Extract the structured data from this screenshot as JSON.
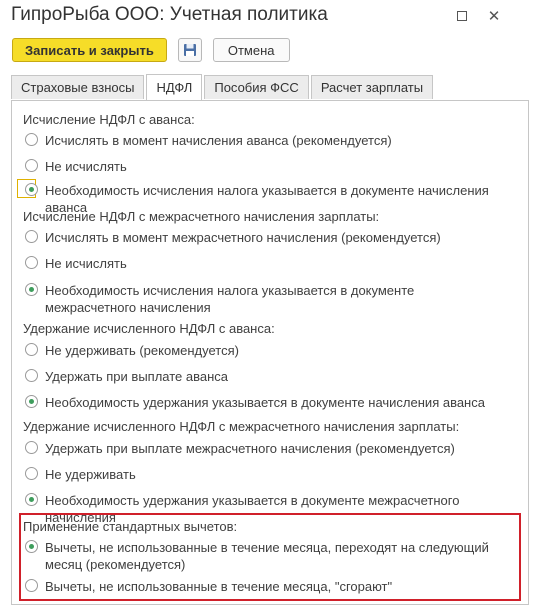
{
  "window": {
    "title": "ГипроРыба ООО: Учетная политика"
  },
  "toolbar": {
    "save_close_label": "Записать и закрыть",
    "cancel_label": "Отмена"
  },
  "tabs": [
    {
      "label": "Страховые взносы"
    },
    {
      "label": "НДФЛ"
    },
    {
      "label": "Пособия ФСС"
    },
    {
      "label": "Расчет зарплаты"
    }
  ],
  "groups": [
    {
      "label": "Исчисление НДФЛ с аванса:",
      "options": [
        {
          "text": "Исчислять в момент начисления аванса (рекомендуется)",
          "checked": false
        },
        {
          "text": "Не исчислять",
          "checked": false
        },
        {
          "text": "Необходимость исчисления налога указывается в документе начисления аванса",
          "checked": true
        }
      ]
    },
    {
      "label": "Исчисление НДФЛ с межрасчетного начисления зарплаты:",
      "options": [
        {
          "text": "Исчислять в момент межрасчетного начисления (рекомендуется)",
          "checked": false
        },
        {
          "text": "Не исчислять",
          "checked": false
        },
        {
          "text": "Необходимость исчисления налога указывается в документе межрасчетного начисления",
          "checked": true
        }
      ]
    },
    {
      "label": "Удержание исчисленного НДФЛ с аванса:",
      "options": [
        {
          "text": "Не удерживать (рекомендуется)",
          "checked": false
        },
        {
          "text": "Удержать при выплате аванса",
          "checked": false
        },
        {
          "text": "Необходимость удержания указывается в документе начисления аванса",
          "checked": true
        }
      ]
    },
    {
      "label": "Удержание исчисленного НДФЛ с межрасчетного начисления зарплаты:",
      "options": [
        {
          "text": "Удержать при выплате межрасчетного начисления (рекомендуется)",
          "checked": false
        },
        {
          "text": "Не удерживать",
          "checked": false
        },
        {
          "text": "Необходимость удержания указывается в документе межрасчетного начисления",
          "checked": true
        }
      ]
    },
    {
      "label": "Применение стандартных вычетов:",
      "options": [
        {
          "text": "Вычеты, не использованные в течение месяца, переходят на следующий месяц (рекомендуется)",
          "checked": true
        },
        {
          "text": "Вычеты, не использованные в течение месяца, \"сгорают\"",
          "checked": false
        }
      ]
    }
  ]
}
